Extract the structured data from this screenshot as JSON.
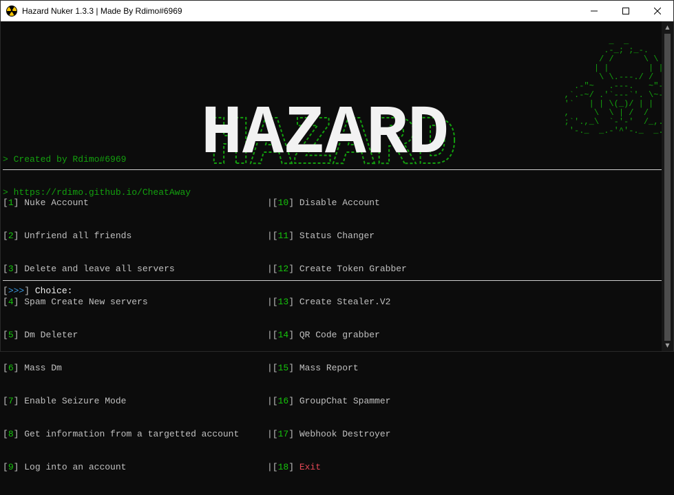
{
  "window": {
    "title": "Hazard Nuker 1.3.3 | Made By Rdimo#6969",
    "icon": "radiation-icon",
    "controls": [
      "minimize-icon",
      "maximize-icon",
      "close-icon"
    ]
  },
  "header": {
    "logo_text": "HAZARD",
    "credit_line1": "> Created by Rdimo#6969",
    "credit_line2": "> https://rdimo.github.io/CheatAway"
  },
  "menu": {
    "left": [
      {
        "num": "1",
        "label": "Nuke Account"
      },
      {
        "num": "2",
        "label": "Unfriend all friends"
      },
      {
        "num": "3",
        "label": "Delete and leave all servers"
      },
      {
        "num": "4",
        "label": "Spam Create New servers"
      },
      {
        "num": "5",
        "label": "Dm Deleter"
      },
      {
        "num": "6",
        "label": "Mass Dm"
      },
      {
        "num": "7",
        "label": "Enable Seizure Mode"
      },
      {
        "num": "8",
        "label": "Get information from a targetted account"
      },
      {
        "num": "9",
        "label": "Log into an account"
      }
    ],
    "right": [
      {
        "num": "10",
        "label": "Disable Account"
      },
      {
        "num": "11",
        "label": "Status Changer"
      },
      {
        "num": "12",
        "label": "Create Token Grabber"
      },
      {
        "num": "13",
        "label": "Create Stealer.V2"
      },
      {
        "num": "14",
        "label": "QR Code grabber"
      },
      {
        "num": "15",
        "label": "Mass Report"
      },
      {
        "num": "16",
        "label": "GroupChat Spammer"
      },
      {
        "num": "17",
        "label": "Webhook Destroyer"
      },
      {
        "num": "18",
        "label": "Exit"
      }
    ]
  },
  "prompt": {
    "arrows": ">>>",
    "label": "Choice:"
  },
  "colors": {
    "background": "#0c0c0c",
    "green": "#13a10e",
    "bright_green": "#16c60c",
    "text": "#c0c0c0",
    "exit": "#e74856",
    "prompt_arrows": "#3a96dd"
  }
}
